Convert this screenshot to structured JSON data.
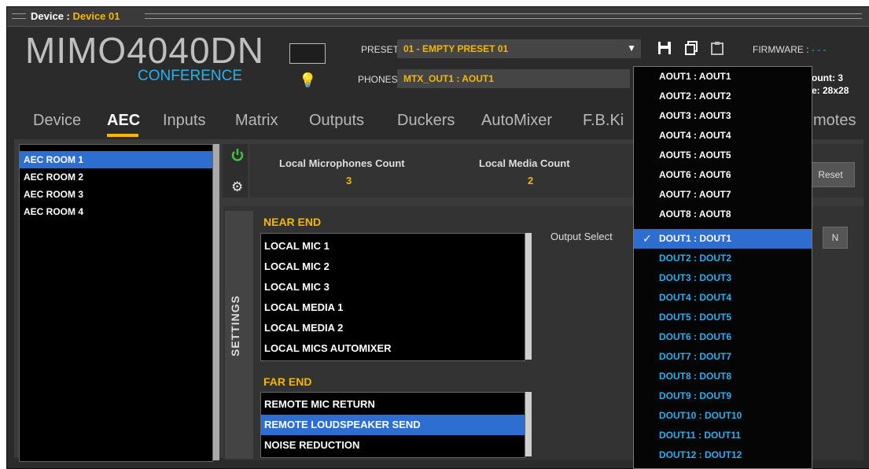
{
  "titlebar": {
    "prefix": "Device : ",
    "device_name": "Device 01"
  },
  "device": {
    "model": "MIMO4040DN",
    "edition": "CONFERENCE"
  },
  "preset": {
    "label": "PRESET",
    "value": "01 - EMPTY PRESET 01"
  },
  "phones": {
    "label": "PHONES",
    "value": "MTX_OUT1 : AOUT1"
  },
  "firmware": {
    "label": "FIRMWARE : ",
    "value": "- - -"
  },
  "right_info": {
    "count": "ount: 3",
    "size": "e: 28x28"
  },
  "tabs": [
    {
      "label": "Device",
      "active": false
    },
    {
      "label": "AEC",
      "active": true
    },
    {
      "label": "Inputs",
      "active": false
    },
    {
      "label": "Matrix",
      "active": false
    },
    {
      "label": "Outputs",
      "active": false
    },
    {
      "label": "Duckers",
      "active": false
    },
    {
      "label": "AutoMixer",
      "active": false
    },
    {
      "label": "F.B.Ki",
      "active": false
    },
    {
      "label": "motes",
      "active": false
    }
  ],
  "rooms": [
    {
      "label": "AEC ROOM 1",
      "selected": true
    },
    {
      "label": "AEC ROOM 2",
      "selected": false
    },
    {
      "label": "AEC ROOM 3",
      "selected": false
    },
    {
      "label": "AEC ROOM 4",
      "selected": false
    }
  ],
  "counts": {
    "mic_label": "Local Microphones Count",
    "mic_value": "3",
    "media_label": "Local Media Count",
    "media_value": "2",
    "reset_label": "Reset"
  },
  "settings": {
    "tab_label": "SETTINGS",
    "near_end_title": "NEAR END",
    "near_end_items": [
      "LOCAL MIC 1",
      "LOCAL MIC 2",
      "LOCAL MIC 3",
      "LOCAL MEDIA 1",
      "LOCAL MEDIA 2",
      "LOCAL MICS AUTOMIXER"
    ],
    "far_end_title": "FAR END",
    "far_end_items": [
      {
        "label": "REMOTE MIC RETURN",
        "selected": false
      },
      {
        "label": "REMOTE LOUDSPEAKER SEND",
        "selected": true
      },
      {
        "label": "NOISE REDUCTION",
        "selected": false
      }
    ],
    "output_select_label": "Output Select",
    "n_button_label": "N"
  },
  "output_dropdown": {
    "selected": "DOUT1 : DOUT1",
    "check_glyph": "✓",
    "options": [
      "AOUT1 : AOUT1",
      "AOUT2 : AOUT2",
      "AOUT3 : AOUT3",
      "AOUT4 : AOUT4",
      "AOUT5 : AOUT5",
      "AOUT6 : AOUT6",
      "AOUT7 : AOUT7",
      "AOUT8 : AOUT8",
      "DOUT1 : DOUT1",
      "DOUT2 : DOUT2",
      "DOUT3 : DOUT3",
      "DOUT4 : DOUT4",
      "DOUT5 : DOUT5",
      "DOUT6 : DOUT6",
      "DOUT7 : DOUT7",
      "DOUT8 : DOUT8",
      "DOUT9 : DOUT9",
      "DOUT10 : DOUT10",
      "DOUT11 : DOUT11",
      "DOUT12 : DOUT12"
    ]
  },
  "colors": {
    "accent": "#f5b800",
    "selection": "#2e6ed1",
    "digital_out": "#29b0f0",
    "power_on": "#3ec43e"
  }
}
